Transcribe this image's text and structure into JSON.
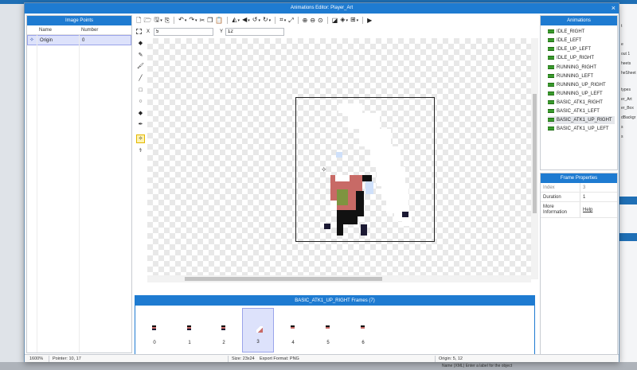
{
  "window": {
    "title": "Animations Editor: Player_Art",
    "close_glyph": "×"
  },
  "image_points": {
    "header": "Image Points",
    "columns": [
      "Name",
      "Number"
    ],
    "rows": [
      {
        "icon": "crosshair-icon",
        "name": "Origin",
        "number": "0"
      }
    ]
  },
  "toolbar": {
    "icons": [
      "new-file-icon",
      "open-folder-icon",
      "save-icon",
      "save-as-icon",
      "undo-icon",
      "redo-icon",
      "cut-icon",
      "copy-icon",
      "paste-icon",
      "flip-horizontal-icon",
      "flip-vertical-icon",
      "rotate-left-icon",
      "rotate-right-icon",
      "crop-icon",
      "resize-icon",
      "zoom-in-icon",
      "zoom-out-icon",
      "zoom-fit-icon",
      "color-adjust-icon",
      "layers-icon",
      "grid-icon",
      "play-icon"
    ],
    "x_label": "X",
    "x_value": "5",
    "y_label": "Y",
    "y_value": "12"
  },
  "tools": [
    "selection",
    "eraser",
    "pencil",
    "brush",
    "line",
    "rectangle",
    "ellipse",
    "fill-bucket",
    "eyedropper",
    "image-point",
    "bone"
  ],
  "frames": {
    "header": "BASIC_ATK1_UP_RIGHT Frames (7)",
    "items": [
      "0",
      "1",
      "2",
      "3",
      "4",
      "5",
      "6"
    ],
    "selected": "3"
  },
  "animations": {
    "header": "Animations",
    "items": [
      "IDLE_RIGHT",
      "IDLE_LEFT",
      "IDLE_UP_LEFT",
      "IDLE_UP_RIGHT",
      "RUNNING_RIGHT",
      "RUNNING_LEFT",
      "RUNNING_UP_RIGHT",
      "RUNNING_UP_LEFT",
      "BASIC_ATK1_RIGHT",
      "BASIC_ATK1_LEFT",
      "BASIC_ATK1_UP_RIGHT",
      "BASIC_ATK1_UP_LEFT"
    ],
    "selected": "BASIC_ATK1_UP_RIGHT"
  },
  "frame_properties": {
    "header": "Frame Properties",
    "index_label": "Index",
    "index_value": "3",
    "duration_label": "Duration",
    "duration_value": "1",
    "more_label_1": "More",
    "more_label_2": "Information",
    "more_value": "Help"
  },
  "status": {
    "zoom": "1600%",
    "pointer": "Pointer: 10, 17",
    "size": "Size: 23x24",
    "export": "Export Format: PNG",
    "origin": "Origin: 5, 12"
  },
  "background": {
    "right_texts": [
      "t",
      "e",
      "out 1",
      "heets",
      "heSheet",
      "types",
      "er_Art",
      "er_Box",
      "dBackgr",
      "s",
      "s"
    ],
    "bottom_text": "Name (XML) Enter a label for the object"
  },
  "colors": {
    "accent": "#1e7bd1",
    "selection": "#dde2fb",
    "sprite_red": "#c86a66",
    "sprite_olive": "#7e9440",
    "sprite_navy": "#1c1a34",
    "sprite_lightblue": "#cfe0fa"
  }
}
